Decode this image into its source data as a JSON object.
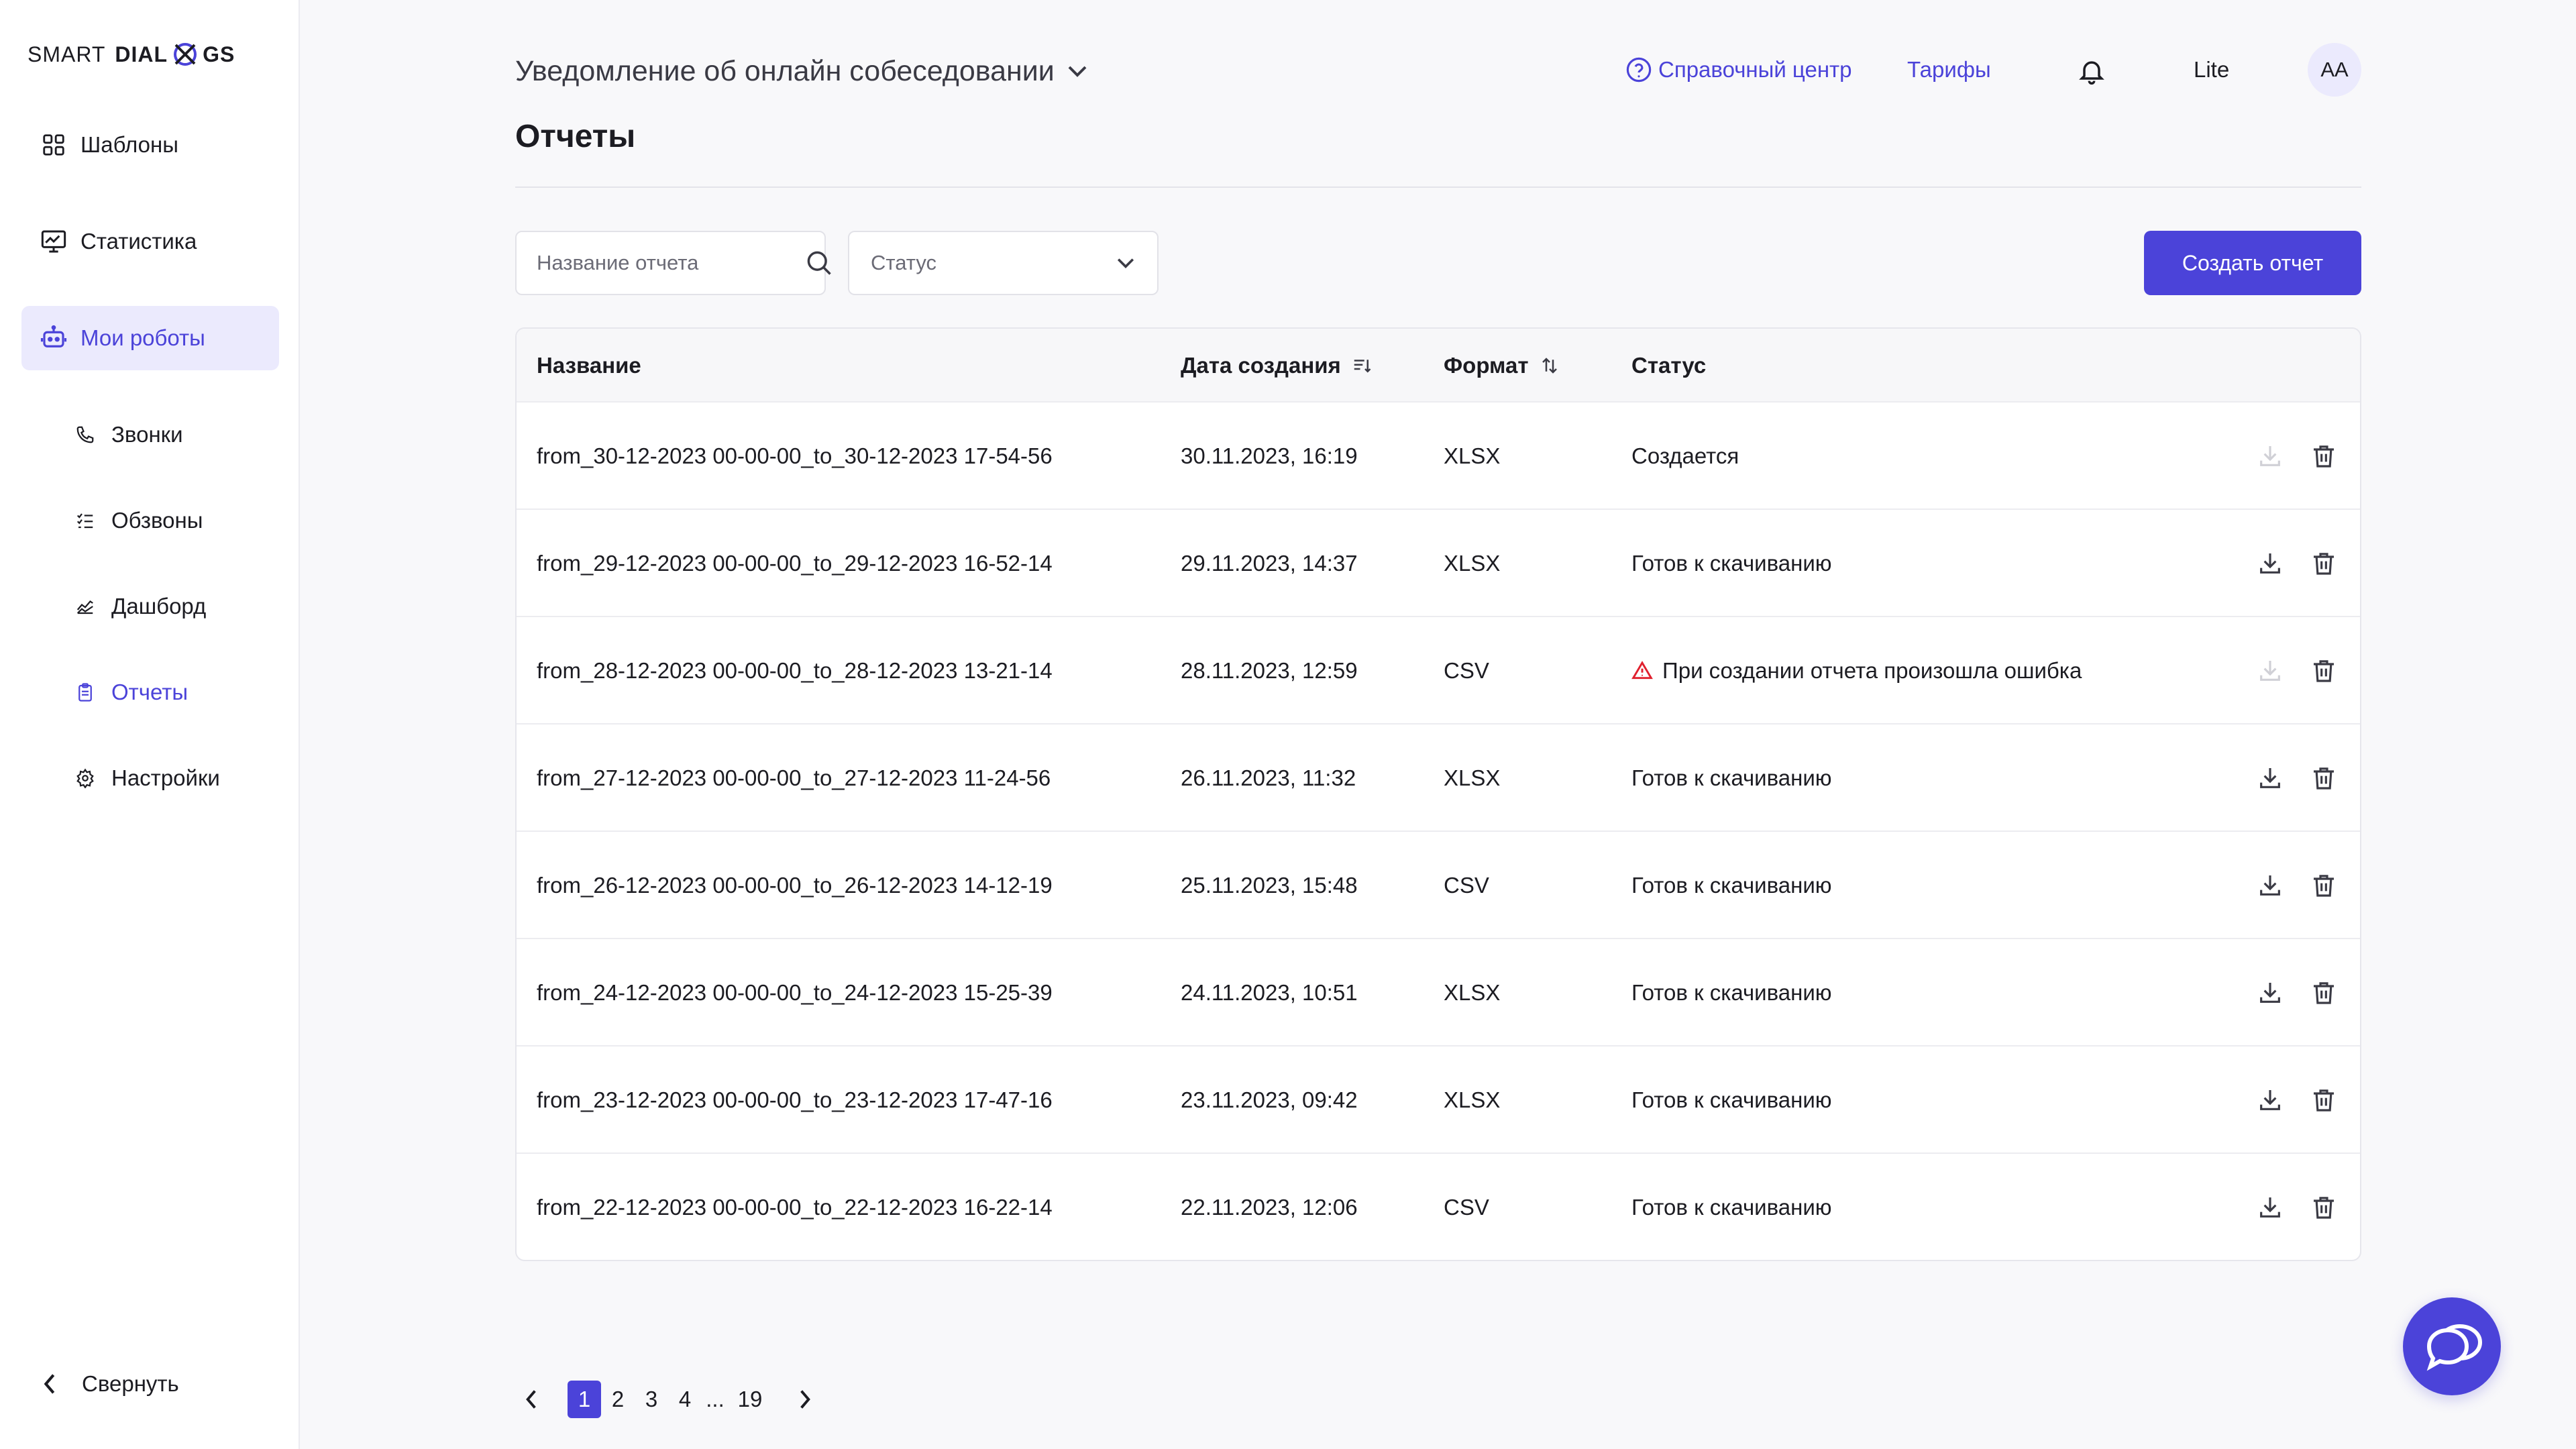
{
  "brand": {
    "left": "SMART",
    "right_a": "DIAL",
    "right_b": "GS"
  },
  "sidebar": {
    "items": [
      {
        "label": "Шаблоны",
        "icon": "grid-icon"
      },
      {
        "label": "Статистика",
        "icon": "chart-monitor-icon"
      },
      {
        "label": "Мои роботы",
        "icon": "robot-icon",
        "active": true
      }
    ],
    "subitems": [
      {
        "label": "Звонки",
        "icon": "phone-icon"
      },
      {
        "label": "Обзвоны",
        "icon": "checklist-icon"
      },
      {
        "label": "Дашборд",
        "icon": "dashboard-icon"
      },
      {
        "label": "Отчеты",
        "icon": "clipboard-icon",
        "active": true
      },
      {
        "label": "Настройки",
        "icon": "gear-icon"
      }
    ],
    "collapse_label": "Свернуть"
  },
  "header": {
    "robot_title": "Уведомление об онлайн собеседовании",
    "help_label": "Справочный центр",
    "tariffs_label": "Тарифы",
    "plan": "Lite",
    "avatar_initials": "АА"
  },
  "page": {
    "title": "Отчеты"
  },
  "filters": {
    "search_placeholder": "Название отчета",
    "status_placeholder": "Статус",
    "create_label": "Создать отчет"
  },
  "table": {
    "columns": {
      "name": "Название",
      "created": "Дата создания",
      "format": "Формат",
      "status": "Статус"
    },
    "rows": [
      {
        "name": "from_30-12-2023 00-00-00_to_30-12-2023 17-54-56",
        "created": "30.11.2023, 16:19",
        "format": "XLSX",
        "status": "Создается",
        "state": "pending"
      },
      {
        "name": "from_29-12-2023 00-00-00_to_29-12-2023 16-52-14",
        "created": "29.11.2023, 14:37",
        "format": "XLSX",
        "status": "Готов к скачиванию",
        "state": "ready"
      },
      {
        "name": "from_28-12-2023 00-00-00_to_28-12-2023 13-21-14",
        "created": "28.11.2023, 12:59",
        "format": "CSV",
        "status": "При создании отчета произошла ошибка",
        "state": "error"
      },
      {
        "name": "from_27-12-2023 00-00-00_to_27-12-2023 11-24-56",
        "created": "26.11.2023, 11:32",
        "format": "XLSX",
        "status": "Готов к скачиванию",
        "state": "ready"
      },
      {
        "name": "from_26-12-2023 00-00-00_to_26-12-2023 14-12-19",
        "created": "25.11.2023, 15:48",
        "format": "CSV",
        "status": "Готов к скачиванию",
        "state": "ready"
      },
      {
        "name": "from_24-12-2023 00-00-00_to_24-12-2023 15-25-39",
        "created": "24.11.2023, 10:51",
        "format": "XLSX",
        "status": "Готов к скачиванию",
        "state": "ready"
      },
      {
        "name": "from_23-12-2023 00-00-00_to_23-12-2023 17-47-16",
        "created": "23.11.2023, 09:42",
        "format": "XLSX",
        "status": "Готов к скачиванию",
        "state": "ready"
      },
      {
        "name": "from_22-12-2023 00-00-00_to_22-12-2023 16-22-14",
        "created": "22.11.2023, 12:06",
        "format": "CSV",
        "status": "Готов к скачиванию",
        "state": "ready"
      }
    ]
  },
  "pagination": {
    "pages": [
      "1",
      "2",
      "3",
      "4",
      "...",
      "19"
    ],
    "current": "1"
  },
  "colors": {
    "accent": "#4b43d9",
    "accent_soft": "#ebeafd",
    "error": "#e0202e",
    "disabled_icon": "#d0d0d6"
  }
}
